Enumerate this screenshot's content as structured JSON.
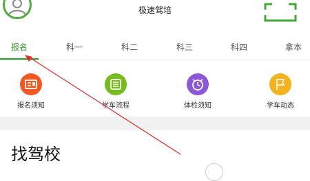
{
  "header": {
    "title": "极速驾培",
    "avatar_icon": "user-avatar-icon",
    "scan_icon": "scan-frame-icon"
  },
  "tabs": [
    {
      "label": "报名",
      "active": true
    },
    {
      "label": "科一",
      "active": false
    },
    {
      "label": "科二",
      "active": false
    },
    {
      "label": "科三",
      "active": false
    },
    {
      "label": "科四",
      "active": false
    },
    {
      "label": "拿本",
      "active": false
    }
  ],
  "features": [
    {
      "label": "报名须知",
      "color": "#f2581f",
      "icon": "id-card-icon"
    },
    {
      "label": "学车流程",
      "color": "#74bd1b",
      "icon": "checklist-icon"
    },
    {
      "label": "体检须知",
      "color": "#8b58d9",
      "icon": "alarm-clock-icon"
    },
    {
      "label": "学车动态",
      "color": "#f4b21c",
      "icon": "flag-icon"
    }
  ],
  "section": {
    "title": "找驾校"
  },
  "colors": {
    "accent": "#34a02c",
    "annotation_arrow": "#e02b2b"
  }
}
